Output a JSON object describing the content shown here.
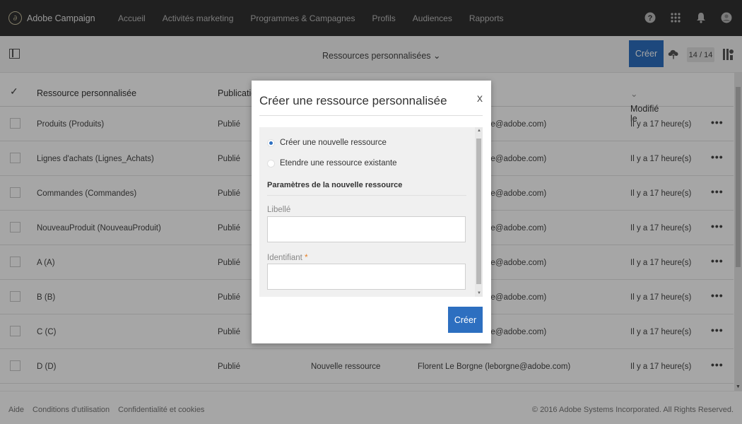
{
  "app": {
    "title": "Adobe Campaign",
    "logo_glyph": "∂"
  },
  "topnav": [
    "Accueil",
    "Activités marketing",
    "Programmes & Campagnes",
    "Profils",
    "Audiences",
    "Rapports"
  ],
  "top_icons": [
    "help-icon",
    "apps-grid-icon",
    "notification-bell-icon",
    "user-avatar-icon"
  ],
  "subheader": {
    "view_title": "Ressources personnalisées",
    "create_label": "Créer",
    "count": "14 / 14"
  },
  "table": {
    "headers": {
      "resource": "Ressource personnalisée",
      "publication": "Publication",
      "modified": "Modifié le"
    },
    "rows": [
      {
        "name": "Produits (Produits)",
        "status": "Publié",
        "type": "",
        "author": "ne@adobe.com)",
        "modified": "Il y a 17 heure(s)"
      },
      {
        "name": "Lignes d'achats (Lignes_Achats)",
        "status": "Publié",
        "type": "",
        "author": "ne@adobe.com)",
        "modified": "Il y a 17 heure(s)"
      },
      {
        "name": "Commandes (Commandes)",
        "status": "Publié",
        "type": "",
        "author": "ne@adobe.com)",
        "modified": "Il y a 17 heure(s)"
      },
      {
        "name": "NouveauProduit (NouveauProduit)",
        "status": "Publié",
        "type": "",
        "author": "ne@adobe.com)",
        "modified": "Il y a 17 heure(s)"
      },
      {
        "name": "A (A)",
        "status": "Publié",
        "type": "",
        "author": "ne@adobe.com)",
        "modified": "Il y a 17 heure(s)"
      },
      {
        "name": "B (B)",
        "status": "Publié",
        "type": "",
        "author": "ne@adobe.com)",
        "modified": "Il y a 17 heure(s)"
      },
      {
        "name": "C (C)",
        "status": "Publié",
        "type": "",
        "author": "ne@adobe.com)",
        "modified": "Il y a 17 heure(s)"
      },
      {
        "name": "D (D)",
        "status": "Publié",
        "type": "Nouvelle ressource",
        "author": "Florent Le Borgne (leborgne@adobe.com)",
        "modified": "Il y a 17 heure(s)"
      }
    ]
  },
  "footer": {
    "links": [
      "Aide",
      "Conditions d'utilisation",
      "Confidentialité et cookies"
    ],
    "copyright": "© 2016 Adobe Systems Incorporated. All Rights Reserved."
  },
  "modal": {
    "title": "Créer une ressource personnalisée",
    "close": "x",
    "option_new": "Créer une nouvelle ressource",
    "option_extend": "Etendre une ressource existante",
    "selected_option": "new",
    "section_title": "Paramètres de la nouvelle ressource",
    "label_field": "Libellé",
    "id_field": "Identifiant",
    "required_mark": "*",
    "label_value": "",
    "id_value": "",
    "create_label": "Créer"
  },
  "colors": {
    "accent": "#2d6fc0",
    "topbar": "#323232",
    "required": "#e67e22"
  }
}
